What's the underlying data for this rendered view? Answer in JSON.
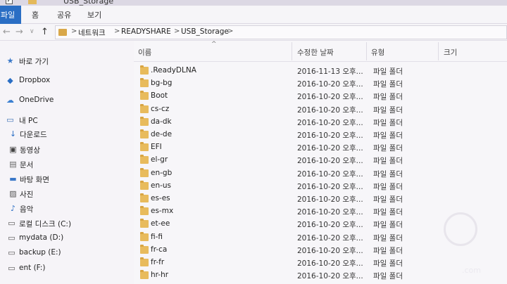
{
  "window": {
    "title": "USB_Storage"
  },
  "ribbon": {
    "tabs": [
      "파일",
      "홈",
      "공유",
      "보기"
    ]
  },
  "address": {
    "crumbs": [
      "네트워크",
      "READYSHARE",
      "USB_Storage"
    ],
    "separator": ">"
  },
  "nav": {
    "back": "←",
    "forward": "→",
    "recent": "∨",
    "up": "↑",
    "items": [
      {
        "label": "바로 가기",
        "icon": "star-icon"
      },
      {
        "label": "Dropbox",
        "icon": "dropbox-icon"
      },
      {
        "label": "OneDrive",
        "icon": "cloud-icon"
      },
      {
        "label": "내 PC",
        "icon": "pc-icon"
      },
      {
        "label": "다운로드",
        "icon": "download-icon"
      },
      {
        "label": "동영상",
        "icon": "video-icon"
      },
      {
        "label": "문서",
        "icon": "document-icon"
      },
      {
        "label": "바탕 화면",
        "icon": "desktop-icon"
      },
      {
        "label": "사진",
        "icon": "picture-icon"
      },
      {
        "label": "음악",
        "icon": "music-icon"
      },
      {
        "label": "로컬 디스크 (C:)",
        "icon": "drive-icon"
      },
      {
        "label": "mydata (D:)",
        "icon": "drive-icon"
      },
      {
        "label": "backup (E:)",
        "icon": "drive-icon"
      },
      {
        "label": "ent (F:)",
        "icon": "drive-icon"
      }
    ]
  },
  "columns": {
    "name": "이름",
    "date": "수정한 날짜",
    "type": "유형",
    "size": "크기",
    "sort_indicator": "^"
  },
  "files": [
    {
      "name": ".ReadyDLNA",
      "date": "2016-11-13 오후...",
      "type": "파일 폴더"
    },
    {
      "name": "bg-bg",
      "date": "2016-10-20 오후...",
      "type": "파일 폴더"
    },
    {
      "name": "Boot",
      "date": "2016-10-20 오후...",
      "type": "파일 폴더"
    },
    {
      "name": "cs-cz",
      "date": "2016-10-20 오후...",
      "type": "파일 폴더"
    },
    {
      "name": "da-dk",
      "date": "2016-10-20 오후...",
      "type": "파일 폴더"
    },
    {
      "name": "de-de",
      "date": "2016-10-20 오후...",
      "type": "파일 폴더"
    },
    {
      "name": "EFI",
      "date": "2016-10-20 오후...",
      "type": "파일 폴더"
    },
    {
      "name": "el-gr",
      "date": "2016-10-20 오후...",
      "type": "파일 폴더"
    },
    {
      "name": "en-gb",
      "date": "2016-10-20 오후...",
      "type": "파일 폴더"
    },
    {
      "name": "en-us",
      "date": "2016-10-20 오후...",
      "type": "파일 폴더"
    },
    {
      "name": "es-es",
      "date": "2016-10-20 오후...",
      "type": "파일 폴더"
    },
    {
      "name": "es-mx",
      "date": "2016-10-20 오후...",
      "type": "파일 폴더"
    },
    {
      "name": "et-ee",
      "date": "2016-10-20 오후...",
      "type": "파일 폴더"
    },
    {
      "name": "fi-fi",
      "date": "2016-10-20 오후...",
      "type": "파일 폴더"
    },
    {
      "name": "fr-ca",
      "date": "2016-10-20 오후...",
      "type": "파일 폴더"
    },
    {
      "name": "fr-fr",
      "date": "2016-10-20 오후...",
      "type": "파일 폴더"
    },
    {
      "name": "hr-hr",
      "date": "2016-10-20 오후...",
      "type": "파일 폴더"
    }
  ],
  "watermark": {
    "text": ".com"
  },
  "colors": {
    "accent": "#2a6ec4",
    "folder": "#e8bb5c"
  }
}
